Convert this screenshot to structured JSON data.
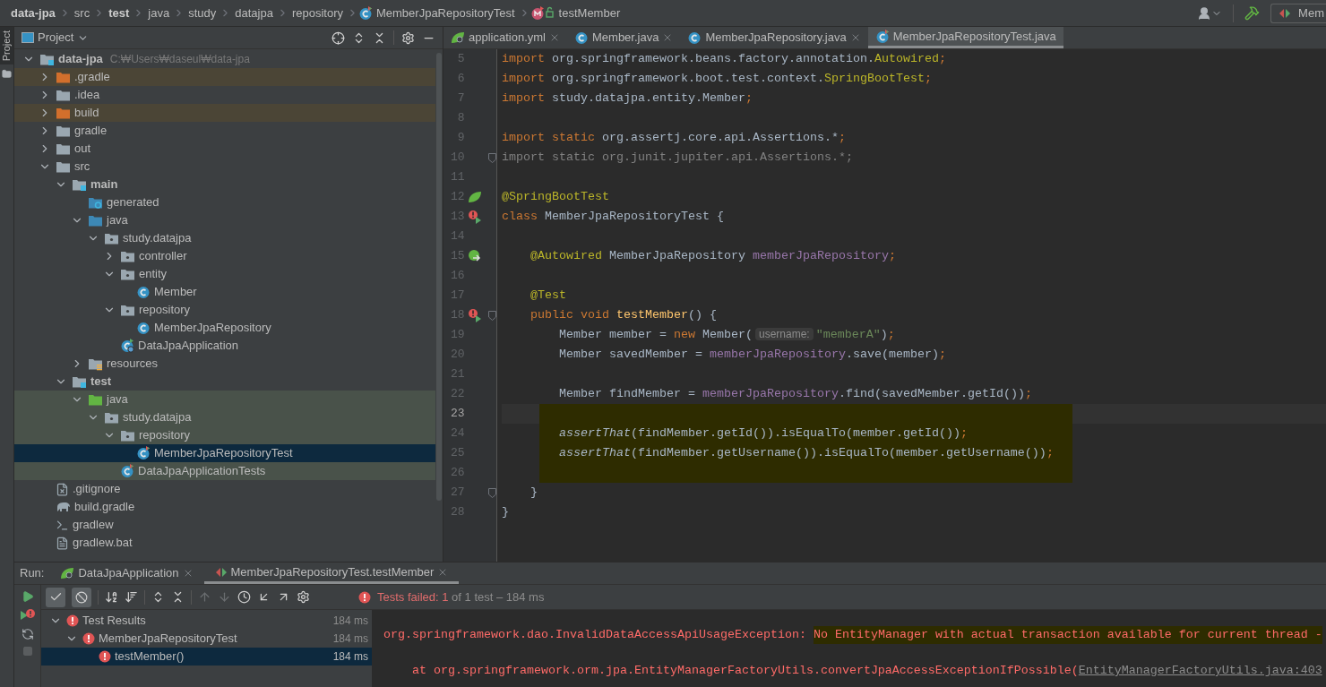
{
  "breadcrumbs": [
    {
      "label": "data-jpa",
      "kind": "project"
    },
    {
      "label": "src",
      "kind": "folder"
    },
    {
      "label": "test",
      "kind": "project"
    },
    {
      "label": "java",
      "kind": "folder"
    },
    {
      "label": "study",
      "kind": "folder"
    },
    {
      "label": "datajpa",
      "kind": "folder"
    },
    {
      "label": "repository",
      "kind": "folder"
    },
    {
      "label": "MemberJpaRepositoryTest",
      "kind": "class"
    },
    {
      "label": "testMember",
      "kind": "method"
    }
  ],
  "run_config": {
    "label": "Mem"
  },
  "project": {
    "side_tab": "Project",
    "title": "Project",
    "tree": [
      {
        "label": "data-jpa",
        "kind": "module",
        "path": "C:₩Users₩daseul₩data-jpa",
        "expanded": true,
        "selected": false,
        "children": [
          {
            "label": ".gradle",
            "kind": "excluded",
            "excluded": true,
            "expanded": false,
            "selected": false
          },
          {
            "label": ".idea",
            "kind": "folder",
            "expanded": false,
            "selected": false
          },
          {
            "label": "build",
            "kind": "excluded",
            "excluded": true,
            "expanded": false,
            "selected": false
          },
          {
            "label": "gradle",
            "kind": "folder",
            "expanded": false,
            "selected": false
          },
          {
            "label": "out",
            "kind": "folder",
            "expanded": false,
            "selected": false
          },
          {
            "label": "src",
            "kind": "folder",
            "expanded": true,
            "selected": false,
            "children": [
              {
                "label": "main",
                "kind": "source_set",
                "expanded": true,
                "selected": false,
                "children": [
                  {
                    "label": "generated",
                    "kind": "generated",
                    "selected": false
                  },
                  {
                    "label": "java",
                    "kind": "source",
                    "expanded": true,
                    "selected": false,
                    "children": [
                      {
                        "label": "study.datajpa",
                        "kind": "package",
                        "expanded": true,
                        "selected": false,
                        "children": [
                          {
                            "label": "controller",
                            "kind": "package",
                            "expanded": false,
                            "selected": false
                          },
                          {
                            "label": "entity",
                            "kind": "package",
                            "expanded": true,
                            "selected": false,
                            "children": [
                              {
                                "label": "Member",
                                "kind": "class",
                                "selected": false
                              }
                            ]
                          },
                          {
                            "label": "repository",
                            "kind": "package",
                            "expanded": true,
                            "selected": false,
                            "children": [
                              {
                                "label": "MemberJpaRepository",
                                "kind": "class",
                                "selected": false
                              }
                            ]
                          },
                          {
                            "label": "DataJpaApplication",
                            "kind": "app",
                            "selected": false
                          }
                        ]
                      }
                    ]
                  },
                  {
                    "label": "resources",
                    "kind": "resources",
                    "expanded": false,
                    "selected": false
                  }
                ]
              },
              {
                "label": "test",
                "kind": "source_set",
                "expanded": true,
                "selected": false,
                "children": [
                  {
                    "label": "java",
                    "kind": "test_source",
                    "in_tests": true,
                    "expanded": true,
                    "selected": false,
                    "children": [
                      {
                        "label": "study.datajpa",
                        "kind": "package",
                        "in_tests": true,
                        "expanded": true,
                        "selected": false,
                        "children": [
                          {
                            "label": "repository",
                            "kind": "package",
                            "in_tests": true,
                            "expanded": true,
                            "selected": false,
                            "children": [
                              {
                                "label": "MemberJpaRepositoryTest",
                                "kind": "test_class",
                                "in_tests": true,
                                "selected": true
                              }
                            ]
                          },
                          {
                            "label": "DataJpaApplicationTests",
                            "kind": "test_class",
                            "in_tests": true,
                            "selected": false
                          }
                        ]
                      }
                    ]
                  }
                ]
              }
            ]
          },
          {
            "label": ".gitignore",
            "kind": "ignore_file",
            "selected": false
          },
          {
            "label": "build.gradle",
            "kind": "gradle_file",
            "selected": false
          },
          {
            "label": "gradlew",
            "kind": "script",
            "selected": false
          },
          {
            "label": "gradlew.bat",
            "kind": "text_file",
            "selected": false
          }
        ]
      }
    ]
  },
  "editor": {
    "tabs": [
      {
        "label": "application.yml",
        "kind": "yml",
        "selected": false
      },
      {
        "label": "Member.java",
        "kind": "class",
        "selected": false
      },
      {
        "label": "MemberJpaRepository.java",
        "kind": "class",
        "selected": false
      },
      {
        "label": "MemberJpaRepositoryTest.java",
        "kind": "test_class",
        "selected": true
      }
    ],
    "lines": [
      {
        "number": "5",
        "current": false,
        "marked": false,
        "tokens": [
          {
            "kind": "keyword",
            "text": "import"
          },
          {
            "kind": "plain",
            "text": " org.springframework.beans.factory.annotation."
          },
          {
            "kind": "annotation",
            "text": "Autowired"
          },
          {
            "kind": "keyword",
            "text": ";"
          }
        ]
      },
      {
        "number": "6",
        "current": false,
        "marked": false,
        "tokens": [
          {
            "kind": "keyword",
            "text": "import"
          },
          {
            "kind": "plain",
            "text": " org.springframework.boot.test.context."
          },
          {
            "kind": "annotation",
            "text": "SpringBootTest"
          },
          {
            "kind": "keyword",
            "text": ";"
          }
        ]
      },
      {
        "number": "7",
        "current": false,
        "marked": false,
        "tokens": [
          {
            "kind": "keyword",
            "text": "import"
          },
          {
            "kind": "plain",
            "text": " study.datajpa.entity.Member"
          },
          {
            "kind": "keyword",
            "text": ";"
          }
        ]
      },
      {
        "number": "8",
        "current": false,
        "marked": false
      },
      {
        "number": "9",
        "current": false,
        "marked": false,
        "tokens": [
          {
            "kind": "keyword",
            "text": "import static"
          },
          {
            "kind": "plain",
            "text": " org.assertj.core.api.Assertions.*"
          },
          {
            "kind": "keyword",
            "text": ";"
          }
        ]
      },
      {
        "number": "10",
        "current": false,
        "marked": false,
        "fold": true,
        "tokens": [
          {
            "kind": "unused",
            "text": "import static org.junit.jupiter.api.Assertions.*;"
          }
        ]
      },
      {
        "number": "11",
        "current": false,
        "marked": false
      },
      {
        "number": "12",
        "current": false,
        "marked": false,
        "gutter": {
          "kind": "spring"
        },
        "tokens": [
          {
            "kind": "annotation",
            "text": "@SpringBootTest"
          }
        ]
      },
      {
        "number": "13",
        "current": false,
        "marked": false,
        "gutter": {
          "kind": "run_failed"
        },
        "tokens": [
          {
            "kind": "keyword",
            "text": "class"
          },
          {
            "kind": "plain",
            "text": " MemberJpaRepositoryTest {"
          }
        ]
      },
      {
        "number": "14",
        "current": false,
        "marked": false
      },
      {
        "number": "15",
        "current": false,
        "marked": false,
        "gutter": {
          "kind": "autowired"
        },
        "tokens": [
          {
            "kind": "annotation",
            "text": "    @Autowired"
          },
          {
            "kind": "plain",
            "text": " MemberJpaRepository "
          },
          {
            "kind": "field",
            "text": "memberJpaRepository"
          },
          {
            "kind": "keyword",
            "text": ";"
          }
        ]
      },
      {
        "number": "16",
        "current": false,
        "marked": false
      },
      {
        "number": "17",
        "current": false,
        "marked": false,
        "tokens": [
          {
            "kind": "annotation",
            "text": "    @Test"
          }
        ]
      },
      {
        "number": "18",
        "current": false,
        "marked": false,
        "gutter": {
          "kind": "run_failed"
        },
        "fold": true,
        "tokens": [
          {
            "kind": "keyword",
            "text": "    public void "
          },
          {
            "kind": "method",
            "text": "testMember"
          },
          {
            "kind": "plain",
            "text": "() {"
          }
        ]
      },
      {
        "number": "19",
        "current": false,
        "marked": false,
        "tokens": [
          {
            "kind": "plain",
            "text": "        Member member = "
          },
          {
            "kind": "keyword",
            "text": "new"
          },
          {
            "kind": "plain",
            "text": " Member("
          },
          {
            "kind": "hint",
            "text": "username:"
          },
          {
            "kind": "string",
            "text": "\"memberA\""
          },
          {
            "kind": "plain",
            "text": ")"
          },
          {
            "kind": "keyword",
            "text": ";"
          }
        ]
      },
      {
        "number": "20",
        "current": false,
        "marked": false,
        "tokens": [
          {
            "kind": "plain",
            "text": "        Member savedMember = "
          },
          {
            "kind": "field",
            "text": "memberJpaRepository"
          },
          {
            "kind": "plain",
            "text": ".save(member)"
          },
          {
            "kind": "keyword",
            "text": ";"
          }
        ]
      },
      {
        "number": "21",
        "current": false,
        "marked": false
      },
      {
        "number": "22",
        "current": false,
        "marked": false,
        "tokens": [
          {
            "kind": "plain",
            "text": "        Member findMember = "
          },
          {
            "kind": "field",
            "text": "memberJpaRepository"
          },
          {
            "kind": "plain",
            "text": ".find(savedMember.getId())"
          },
          {
            "kind": "keyword",
            "text": ";"
          }
        ]
      },
      {
        "number": "23",
        "current": true,
        "marked": true
      },
      {
        "number": "24",
        "current": false,
        "marked": true,
        "tokens": [
          {
            "kind": "static_call",
            "text": "        assertThat"
          },
          {
            "kind": "plain",
            "text": "(findMember.getId()).isEqualTo(member.getId())"
          },
          {
            "kind": "keyword",
            "text": ";"
          }
        ]
      },
      {
        "number": "25",
        "current": false,
        "marked": true,
        "tokens": [
          {
            "kind": "static_call",
            "text": "        assertThat"
          },
          {
            "kind": "plain",
            "text": "(findMember.getUsername()).isEqualTo(member.getUsername())"
          },
          {
            "kind": "keyword",
            "text": ";"
          }
        ]
      },
      {
        "number": "26",
        "current": false,
        "marked": true
      },
      {
        "number": "27",
        "current": false,
        "marked": false,
        "fold": true,
        "tokens": [
          {
            "kind": "plain",
            "text": "    }"
          }
        ]
      },
      {
        "number": "28",
        "current": false,
        "marked": false,
        "tokens": [
          {
            "kind": "plain",
            "text": "}"
          }
        ]
      }
    ]
  },
  "run": {
    "label": "Run:",
    "tabs": [
      {
        "label": "DataJpaApplication",
        "kind": "spring",
        "selected": false
      },
      {
        "label": "MemberJpaRepositoryTest.testMember",
        "kind": "test",
        "selected": true
      }
    ],
    "show_passed": true,
    "show_ignored": true,
    "status": [
      {
        "kind": "error",
        "text": "Tests failed: "
      },
      {
        "kind": "error",
        "text": "1"
      },
      {
        "kind": "muted",
        "text": " of 1 test – 184 ms"
      }
    ],
    "results": [
      {
        "label": "Test Results",
        "time": "184 ms",
        "kind": "failed",
        "expanded": true,
        "selected": false,
        "children": [
          {
            "label": "MemberJpaRepositoryTest",
            "time": "184 ms",
            "kind": "failed",
            "expanded": true,
            "selected": false,
            "children": [
              {
                "label": "testMember()",
                "time": "184 ms",
                "kind": "failed",
                "selected": true
              }
            ]
          }
        ]
      }
    ],
    "console": [
      {
        "parts": [
          {
            "kind": "error",
            "text": "org.springframework.dao.InvalidDataAccessApiUsageException: ",
            "marked": false
          },
          {
            "kind": "error",
            "text": "No EntityManager with actual transaction available for current thread -",
            "marked": true
          }
        ]
      },
      {
        "parts": [
          {
            "kind": "error",
            "text": "    at org.springframework.orm.jpa.EntityManagerFactoryUtils.convertJpaAccessExceptionIfPossible(",
            "marked": false
          },
          {
            "kind": "link",
            "text": "EntityManagerFactoryUtils.java:403",
            "marked": false
          }
        ]
      }
    ]
  }
}
